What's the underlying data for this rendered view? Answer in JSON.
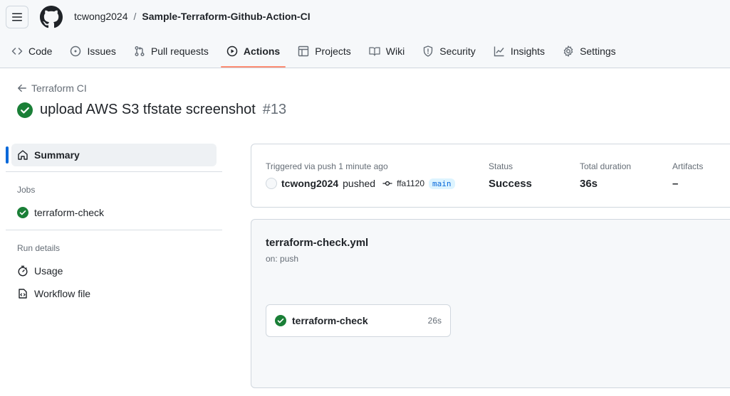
{
  "header": {
    "owner": "tcwong2024",
    "separator": "/",
    "repo": "Sample-Terraform-Github-Action-CI"
  },
  "tabs": [
    {
      "label": "Code",
      "icon": "code-icon"
    },
    {
      "label": "Issues",
      "icon": "issue-icon"
    },
    {
      "label": "Pull requests",
      "icon": "pull-request-icon"
    },
    {
      "label": "Actions",
      "icon": "play-icon",
      "active": true
    },
    {
      "label": "Projects",
      "icon": "table-icon"
    },
    {
      "label": "Wiki",
      "icon": "book-icon"
    },
    {
      "label": "Security",
      "icon": "shield-icon"
    },
    {
      "label": "Insights",
      "icon": "graph-icon"
    },
    {
      "label": "Settings",
      "icon": "gear-icon"
    }
  ],
  "run": {
    "back_label": "Terraform CI",
    "title": "upload AWS S3 tfstate screenshot",
    "number": "#13"
  },
  "sidebar": {
    "summary": "Summary",
    "jobs_label": "Jobs",
    "jobs": [
      "terraform-check"
    ],
    "run_details_label": "Run details",
    "usage": "Usage",
    "workflow_file": "Workflow file"
  },
  "summary_card": {
    "trigger_label": "Triggered via push 1 minute ago",
    "actor": "tcwong2024",
    "pushed": "pushed",
    "commit": "ffa1120",
    "branch": "main",
    "status_label": "Status",
    "status_value": "Success",
    "duration_label": "Total duration",
    "duration_value": "36s",
    "artifacts_label": "Artifacts",
    "artifacts_value": "–"
  },
  "workflow": {
    "file": "terraform-check.yml",
    "trigger": "on: push",
    "job_name": "terraform-check",
    "job_time": "26s"
  },
  "colors": {
    "success": "#1a7f37",
    "accent": "#0969da",
    "tab_underline": "#fd8c73"
  }
}
